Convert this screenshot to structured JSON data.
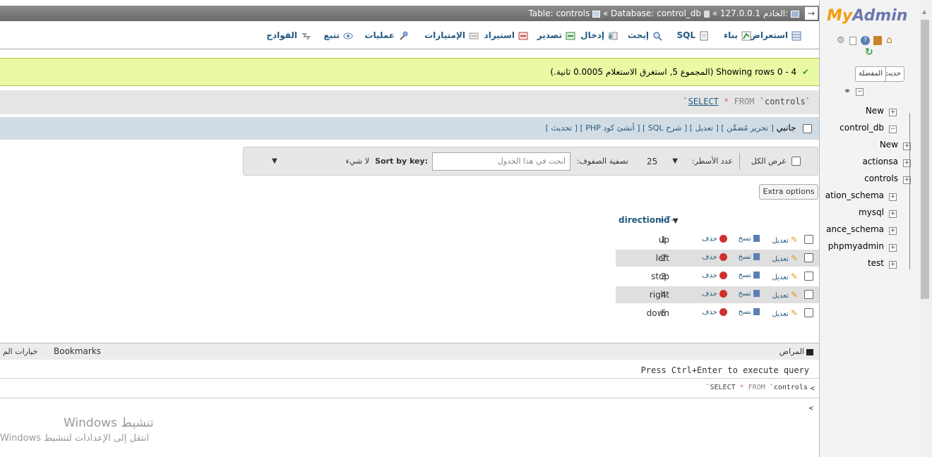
{
  "breadcrumb": {
    "server_label": "الخادم:",
    "server": "127.0.0.1",
    "database_label": "Database:",
    "database": "control_db",
    "table_label": "Table:",
    "table": "controls",
    "sep": "«"
  },
  "tabs": [
    {
      "label": "استعراض",
      "icon": "browse-icon"
    },
    {
      "label": "بناء",
      "icon": "structure-icon"
    },
    {
      "label": "SQL",
      "icon": "sql-icon"
    },
    {
      "label": "إبحث",
      "icon": "search-icon"
    },
    {
      "label": "إدخال",
      "icon": "insert-icon"
    },
    {
      "label": "تصدير",
      "icon": "export-icon"
    },
    {
      "label": "استيراد",
      "icon": "import-icon"
    },
    {
      "label": "الإمتيازات",
      "icon": "privileges-icon"
    },
    {
      "label": "عمليات",
      "icon": "operations-icon"
    },
    {
      "label": "تتبع",
      "icon": "tracking-icon"
    },
    {
      "label": "القوادح",
      "icon": "triggers-icon"
    }
  ],
  "success": {
    "text": "Showing rows 0 - 4 (المجموع 5, استغرق الاستعلام 0.0005 ثانية.)"
  },
  "sql": {
    "query_keyword1": "SELECT",
    "query_star": " * ",
    "query_keyword2": "FROM",
    "query_table": " `controls`"
  },
  "sql_links": {
    "label": "جانبي",
    "links": "[ تحرير مُضمَّن ] [ تعديل ] [ شرح SQL ] [ أنشئ كود PHP ] [ تحديث ]"
  },
  "nav": {
    "show_all": "عرض الكل",
    "rows_label": "عدد الأسطر:",
    "rows_value": "25",
    "filter_label": "تصفية الصفوف:",
    "filter_placeholder": "ابحث في هذا الجدول",
    "sort_label": "Sort by key:",
    "sort_value": "لا شيء",
    "extra_options": "Extra options"
  },
  "table": {
    "arrows": "←T→",
    "columns": [
      "id",
      "direction"
    ],
    "actions": {
      "edit": "تعديل",
      "copy": "نسخ",
      "delete": "حذف"
    },
    "rows": [
      {
        "id": "1",
        "direction": "up"
      },
      {
        "id": "2",
        "direction": "left"
      },
      {
        "id": "3",
        "direction": "stop"
      },
      {
        "id": "4",
        "direction": "right"
      },
      {
        "id": "5",
        "direction": "down"
      }
    ]
  },
  "console": {
    "title": "المراض",
    "bookmarks": "Bookmarks",
    "options": "خيارات الم",
    "hint": "Press Ctrl+Enter to execute query",
    "history_query": "`SELECT * FROM `controls",
    "prompt": "<"
  },
  "watermark": {
    "line1": "تنشيط Windows",
    "line2": "انتقل إلى الإعدادات لتنشيط Windows"
  },
  "sidebar": {
    "logo_a": "My",
    "logo_b": "Admin",
    "recent": "حديث",
    "favorites": "المفضلة",
    "tree": [
      {
        "label": "New",
        "level": 0
      },
      {
        "label": "control_db",
        "level": 0
      },
      {
        "label": "New",
        "level": 1
      },
      {
        "label": "actionsa",
        "level": 1
      },
      {
        "label": "controls",
        "level": 1
      },
      {
        "label": "ation_schema",
        "level": 0
      },
      {
        "label": "mysql",
        "level": 0
      },
      {
        "label": "ance_schema",
        "level": 0
      },
      {
        "label": "phpmyadmin",
        "level": 0
      },
      {
        "label": "test",
        "level": 0
      }
    ]
  },
  "colors": {
    "link": "#235a81",
    "success_bg": "#ebf8a4",
    "logo_blue": "#6c78af",
    "logo_orange": "#f89c0e"
  }
}
